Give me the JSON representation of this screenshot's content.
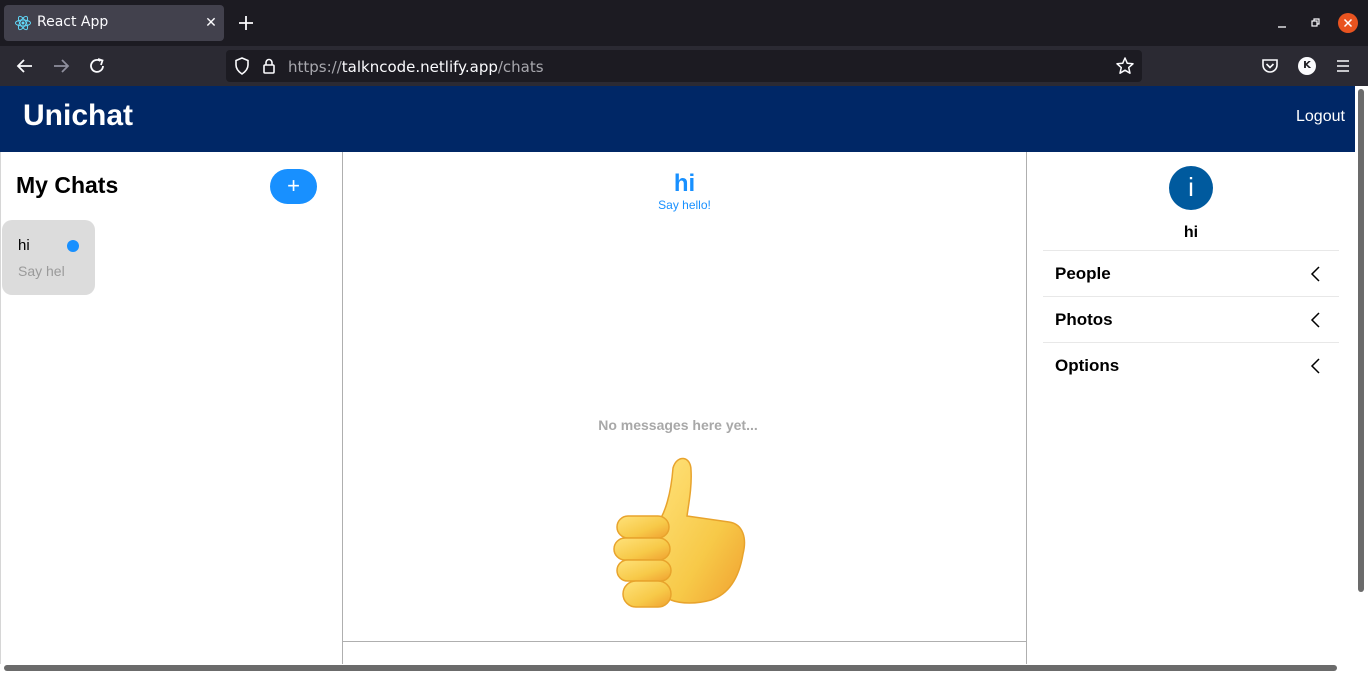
{
  "browser": {
    "tab_title": "React App",
    "url_host": "https://talkncode.netlify.app",
    "url_path": "/chats",
    "profile_initial": "K"
  },
  "navbar": {
    "brand": "Unichat",
    "logout_label": "Logout",
    "color": "#002766"
  },
  "sidebar": {
    "title": "My Chats",
    "new_chat_label": "+",
    "chats": [
      {
        "title": "hi",
        "subtitle": "Say hel"
      }
    ]
  },
  "chat": {
    "title": "hi",
    "subtitle": "Say hello!",
    "empty_text": "No messages here yet...",
    "empty_icon": "thumbs-up-icon"
  },
  "info_panel": {
    "avatar_initial": "i",
    "name": "hi",
    "sections": [
      {
        "label": "People"
      },
      {
        "label": "Photos"
      },
      {
        "label": "Options"
      }
    ]
  },
  "colors": {
    "accent": "#1890ff",
    "avatar": "#005a9e"
  }
}
